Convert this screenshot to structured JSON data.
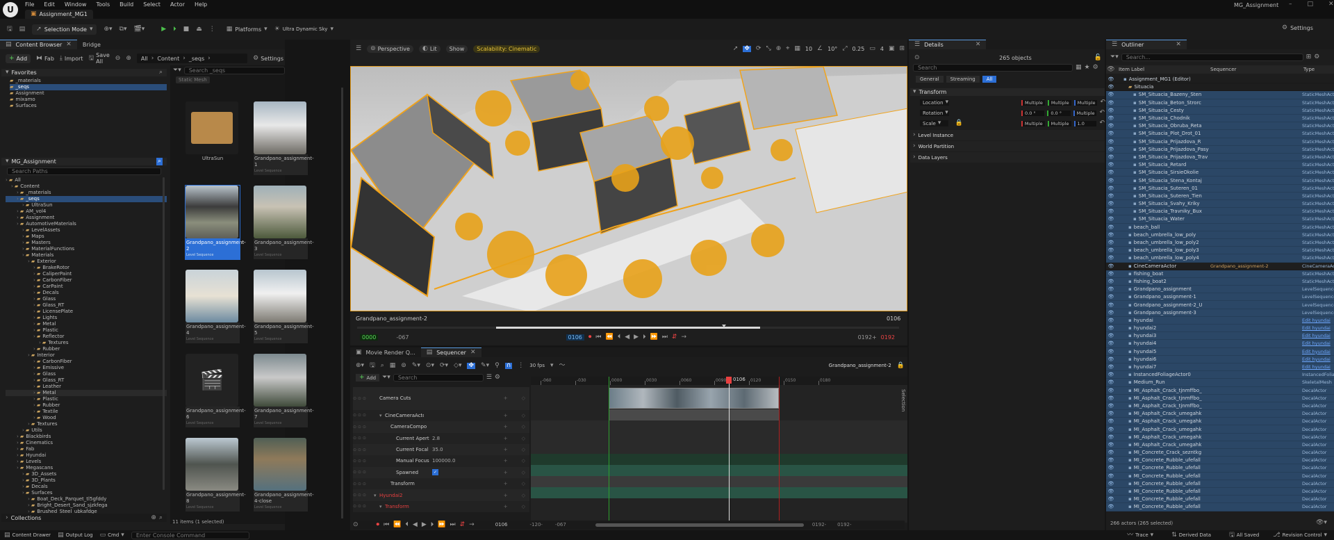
{
  "menubar": {
    "menus": [
      "File",
      "Edit",
      "Window",
      "Tools",
      "Build",
      "Select",
      "Actor",
      "Help"
    ],
    "project_title": "MG_Assignment",
    "tab": "Assignment_MG1"
  },
  "toolbar": {
    "selection_mode": "Selection Mode",
    "platforms": "Platforms",
    "sky": "Ultra Dynamic Sky",
    "settings": "Settings"
  },
  "content_browser": {
    "tabs": [
      "Content Browser",
      "Bridge"
    ],
    "add": "Add",
    "fab": "Fab",
    "import": "Import",
    "save_all": "Save All",
    "settings": "Settings",
    "path": [
      "All",
      "Content",
      "_seqs"
    ],
    "favorites_label": "Favorites",
    "favorites": [
      "_materials",
      "_seqs",
      "Assignment",
      "mixamo",
      "Surfaces"
    ],
    "root_label": "MG_Assignment",
    "search_paths_placeholder": "Search Paths",
    "search_placeholder": "Search _seqs",
    "filter_chip": "Static Mesh",
    "tree": [
      {
        "label": "All",
        "d": 0
      },
      {
        "label": "Content",
        "d": 1
      },
      {
        "label": "_materials",
        "d": 2
      },
      {
        "label": "_seqs",
        "d": 2,
        "sel": true
      },
      {
        "label": "UltraSun",
        "d": 3
      },
      {
        "label": "AM_vol4",
        "d": 2
      },
      {
        "label": "Assignment",
        "d": 2
      },
      {
        "label": "AutomotiveMaterials",
        "d": 2
      },
      {
        "label": "LevelAssets",
        "d": 3
      },
      {
        "label": "Maps",
        "d": 3
      },
      {
        "label": "Masters",
        "d": 3
      },
      {
        "label": "MaterialFunctions",
        "d": 3
      },
      {
        "label": "Materials",
        "d": 3
      },
      {
        "label": "Exterior",
        "d": 4
      },
      {
        "label": "BrakeRotor",
        "d": 5
      },
      {
        "label": "CaliperPaint",
        "d": 5
      },
      {
        "label": "CarbonFiber",
        "d": 5
      },
      {
        "label": "CarPaint",
        "d": 5
      },
      {
        "label": "Decals",
        "d": 5
      },
      {
        "label": "Glass",
        "d": 5
      },
      {
        "label": "Glass_RT",
        "d": 5
      },
      {
        "label": "LicensePlate",
        "d": 5
      },
      {
        "label": "Lights",
        "d": 5
      },
      {
        "label": "Metal",
        "d": 5
      },
      {
        "label": "Plastic",
        "d": 5
      },
      {
        "label": "Reflector",
        "d": 5
      },
      {
        "label": "Textures",
        "d": 6
      },
      {
        "label": "Rubber",
        "d": 5
      },
      {
        "label": "Interior",
        "d": 4
      },
      {
        "label": "CarbonFiber",
        "d": 5
      },
      {
        "label": "Emissive",
        "d": 5
      },
      {
        "label": "Glass",
        "d": 5
      },
      {
        "label": "Glass_RT",
        "d": 5
      },
      {
        "label": "Leather",
        "d": 5
      },
      {
        "label": "Metal",
        "d": 5,
        "hi": true
      },
      {
        "label": "Plastic",
        "d": 5
      },
      {
        "label": "Rubber",
        "d": 5
      },
      {
        "label": "Textile",
        "d": 5
      },
      {
        "label": "Wood",
        "d": 5
      },
      {
        "label": "Textures",
        "d": 4
      },
      {
        "label": "Utils",
        "d": 3
      },
      {
        "label": "Blackbirds",
        "d": 2
      },
      {
        "label": "Cinematics",
        "d": 2
      },
      {
        "label": "Fab",
        "d": 2
      },
      {
        "label": "Hyundai",
        "d": 2
      },
      {
        "label": "Levels",
        "d": 2
      },
      {
        "label": "Megascans",
        "d": 2
      },
      {
        "label": "3D_Assets",
        "d": 3
      },
      {
        "label": "3D_Plants",
        "d": 3
      },
      {
        "label": "Decals",
        "d": 3
      },
      {
        "label": "Surfaces",
        "d": 3
      },
      {
        "label": "Boat_Deck_Parquet_tl5gfddy",
        "d": 4
      },
      {
        "label": "Bright_Desert_Sand_sjzkfega",
        "d": 4
      },
      {
        "label": "Brushed_Steel_ubkafdge",
        "d": 4
      }
    ],
    "assets": [
      {
        "name": "UltraSun",
        "sub": "",
        "kind": "folder"
      },
      {
        "name": "Grandpano_assignment-1",
        "sub": "Level Sequence",
        "kind": "photo1"
      },
      {
        "name": "Grandpano_assignment-2",
        "sub": "Level Sequence",
        "kind": "photo2",
        "selected": true
      },
      {
        "name": "Grandpano_assignment-3",
        "sub": "Level Sequence",
        "kind": "photo3"
      },
      {
        "name": "Grandpano_assignment-4",
        "sub": "Level Sequence",
        "kind": "photo4"
      },
      {
        "name": "Grandpano_assignment-5",
        "sub": "Level Sequence",
        "kind": "photo5"
      },
      {
        "name": "Grandpano_assignment-6",
        "sub": "Level Sequence",
        "kind": "clapper"
      },
      {
        "name": "Grandpano_assignment-7",
        "sub": "Level Sequence",
        "kind": "photo6"
      },
      {
        "name": "Grandpano_assignment-8",
        "sub": "Level Sequence",
        "kind": "photo7"
      },
      {
        "name": "Grandpano_assignment-4-close",
        "sub": "Level Sequence",
        "kind": "photo8"
      }
    ],
    "status": "11 items (1 selected)",
    "collections": "Collections"
  },
  "viewport": {
    "perspective": "Perspective",
    "lit": "Lit",
    "show": "Show",
    "scalability": "Scalability: Cinematic",
    "grid": "10",
    "angle": "10°",
    "scale": "0.25",
    "cam": "4",
    "seq_name": "Grandpano_assignment-2",
    "frame_right": "0106",
    "start": "0000",
    "prestart": "-067",
    "cursor": "0106",
    "end": "0192+",
    "post": "0192"
  },
  "details": {
    "tab": "Details",
    "count": "265 objects",
    "search": "Search",
    "filters": [
      "General",
      "Streaming",
      "All"
    ],
    "section": "Transform",
    "location": "Location",
    "rotation": "Rotation",
    "scale": "Scale",
    "multiple": "Multiple",
    "rot_val": "0.0 °",
    "scale_val": "1.0",
    "sections": [
      "Level Instance",
      "World Partition",
      "Data Layers"
    ]
  },
  "outliner": {
    "tab": "Outliner",
    "search": "Search...",
    "col_label": "Item Label",
    "col_seq": "Sequencer",
    "col_type": "Type",
    "rows": [
      {
        "n": "Assignment_MG1 (Editor)",
        "t": "",
        "d": 1,
        "sel": false
      },
      {
        "n": "Situacia",
        "t": "",
        "d": 2,
        "sel": false,
        "folder": true
      },
      {
        "n": "SM_Situacia_Bazeny_Sten",
        "t": "StaticMeshAct",
        "d": 3,
        "sel": true
      },
      {
        "n": "SM_Situacia_Beton_Strorc",
        "t": "StaticMeshAct",
        "d": 3,
        "sel": true
      },
      {
        "n": "SM_Situacia_Cesty",
        "t": "StaticMeshAct",
        "d": 3,
        "sel": true
      },
      {
        "n": "SM_Situacia_Chodnik",
        "t": "StaticMeshAct",
        "d": 3,
        "sel": true
      },
      {
        "n": "SM_Situacia_Obruba_Reta",
        "t": "StaticMeshAct",
        "d": 3,
        "sel": true
      },
      {
        "n": "SM_Situacia_Plot_Drot_01",
        "t": "StaticMeshAct",
        "d": 3,
        "sel": true
      },
      {
        "n": "SM_Situacia_Prijazdova_R",
        "t": "StaticMeshAct",
        "d": 3,
        "sel": true
      },
      {
        "n": "SM_Situacia_Prijazdova_Pasy",
        "t": "StaticMeshAct",
        "d": 3,
        "sel": true
      },
      {
        "n": "SM_Situacia_Prijazdova_Trav",
        "t": "StaticMeshAct",
        "d": 3,
        "sel": true
      },
      {
        "n": "SM_Situacia_Retard",
        "t": "StaticMeshAct",
        "d": 3,
        "sel": true
      },
      {
        "n": "SM_Situacia_SirsieOkolie",
        "t": "StaticMeshAct",
        "d": 3,
        "sel": true
      },
      {
        "n": "SM_Situacia_Stena_Kontaj",
        "t": "StaticMeshAct",
        "d": 3,
        "sel": true
      },
      {
        "n": "SM_Situacia_Suteren_01",
        "t": "StaticMeshAct",
        "d": 3,
        "sel": true
      },
      {
        "n": "SM_Situacia_Suteren_Tien",
        "t": "StaticMeshAct",
        "d": 3,
        "sel": true
      },
      {
        "n": "SM_Situacia_Svahy_Kriky",
        "t": "StaticMeshAct",
        "d": 3,
        "sel": true
      },
      {
        "n": "SM_Situacia_Travniky_Bux",
        "t": "StaticMeshAct",
        "d": 3,
        "sel": true
      },
      {
        "n": "SM_Situacia_Water",
        "t": "StaticMeshAct",
        "d": 3,
        "sel": true
      },
      {
        "n": "beach_ball",
        "t": "StaticMeshAct",
        "d": 2,
        "sel": true
      },
      {
        "n": "beach_umbrella_low_poly",
        "t": "StaticMeshAct",
        "d": 2,
        "sel": true
      },
      {
        "n": "beach_umbrella_low_poly2",
        "t": "StaticMeshAct",
        "d": 2,
        "sel": true
      },
      {
        "n": "beach_umbrella_low_poly3",
        "t": "StaticMeshAct",
        "d": 2,
        "sel": true
      },
      {
        "n": "beach_umbrella_low_poly4",
        "t": "StaticMeshAct",
        "d": 2,
        "sel": true
      },
      {
        "n": "CineCameraActor",
        "t": "CineCameraAct",
        "d": 2,
        "sel": false,
        "seq": "Grandpano_assignment-2"
      },
      {
        "n": "fishing_boat",
        "t": "StaticMeshAct",
        "d": 2,
        "sel": true
      },
      {
        "n": "fishing_boat2",
        "t": "StaticMeshAct",
        "d": 2,
        "sel": true
      },
      {
        "n": "Grandpano_assignment",
        "t": "LevelSequence",
        "d": 2,
        "sel": true
      },
      {
        "n": "Grandpano_assignment-1",
        "t": "LevelSequence",
        "d": 2,
        "sel": true
      },
      {
        "n": "Grandpano_assignment-2_U",
        "t": "LevelSequence",
        "d": 2,
        "sel": true
      },
      {
        "n": "Grandpano_assignment-3",
        "t": "LevelSequence",
        "d": 2,
        "sel": true
      },
      {
        "n": "hyundai",
        "t": "Edit hyundai",
        "d": 2,
        "sel": true,
        "link": true
      },
      {
        "n": "hyundai2",
        "t": "Edit hyundai",
        "d": 2,
        "sel": true,
        "link": true
      },
      {
        "n": "hyundai3",
        "t": "Edit hyundai",
        "d": 2,
        "sel": true,
        "link": true
      },
      {
        "n": "hyundai4",
        "t": "Edit hyundai",
        "d": 2,
        "sel": true,
        "link": true
      },
      {
        "n": "hyundai5",
        "t": "Edit hyundai",
        "d": 2,
        "sel": true,
        "link": true
      },
      {
        "n": "hyundai6",
        "t": "Edit hyundai",
        "d": 2,
        "sel": true,
        "link": true
      },
      {
        "n": "hyundai7",
        "t": "Edit hyundai",
        "d": 2,
        "sel": true,
        "link": true
      },
      {
        "n": "InstancedFoliageActor0",
        "t": "InstancedFolia",
        "d": 2,
        "sel": true
      },
      {
        "n": "Medium_Run",
        "t": "SkeletalMesh",
        "d": 2,
        "sel": true
      },
      {
        "n": "MI_Asphalt_Crack_tjnmffbo_",
        "t": "DecalActor",
        "d": 2,
        "sel": true
      },
      {
        "n": "MI_Asphalt_Crack_tjnmffbo_",
        "t": "DecalActor",
        "d": 2,
        "sel": true
      },
      {
        "n": "MI_Asphalt_Crack_tjnmffbo_",
        "t": "DecalActor",
        "d": 2,
        "sel": true
      },
      {
        "n": "MI_Asphalt_Crack_umegahk",
        "t": "DecalActor",
        "d": 2,
        "sel": true
      },
      {
        "n": "MI_Asphalt_Crack_umegahk",
        "t": "DecalActor",
        "d": 2,
        "sel": true
      },
      {
        "n": "MI_Asphalt_Crack_umegahk",
        "t": "DecalActor",
        "d": 2,
        "sel": true
      },
      {
        "n": "MI_Asphalt_Crack_umegahk",
        "t": "DecalActor",
        "d": 2,
        "sel": true
      },
      {
        "n": "MI_Asphalt_Crack_umegahk",
        "t": "DecalActor",
        "d": 2,
        "sel": true
      },
      {
        "n": "MI_Concrete_Crack_sezntkg",
        "t": "DecalActor",
        "d": 2,
        "sel": true
      },
      {
        "n": "MI_Concrete_Rubble_ufefall",
        "t": "DecalActor",
        "d": 2,
        "sel": true
      },
      {
        "n": "MI_Concrete_Rubble_ufefall",
        "t": "DecalActor",
        "d": 2,
        "sel": true
      },
      {
        "n": "MI_Concrete_Rubble_ufefall",
        "t": "DecalActor",
        "d": 2,
        "sel": true
      },
      {
        "n": "MI_Concrete_Rubble_ufefall",
        "t": "DecalActor",
        "d": 2,
        "sel": true
      },
      {
        "n": "MI_Concrete_Rubble_ufefall",
        "t": "DecalActor",
        "d": 2,
        "sel": true
      },
      {
        "n": "MI_Concrete_Rubble_ufefall",
        "t": "DecalActor",
        "d": 2,
        "sel": true
      },
      {
        "n": "MI_Concrete_Rubble_ufefall",
        "t": "DecalActor",
        "d": 2,
        "sel": true
      }
    ],
    "status": "266 actors (265 selected)"
  },
  "sequencer": {
    "tabs": [
      "Movie Render Q...",
      "Sequencer"
    ],
    "fps": "30 fps",
    "name": "Grandpano_assignment-2",
    "add": "Add",
    "search": "Search",
    "tracks": [
      {
        "label": "Camera Cuts",
        "d": 0,
        "val": ""
      },
      {
        "label": "CineCameraActor",
        "d": 1,
        "val": ""
      },
      {
        "label": "CameraComponent",
        "d": 2,
        "val": ""
      },
      {
        "label": "Current Aperture",
        "d": 3,
        "val": "2.8"
      },
      {
        "label": "Current Focal Le",
        "d": 3,
        "val": "35.0"
      },
      {
        "label": "Manual Focus D",
        "d": 3,
        "val": "100000.0"
      },
      {
        "label": "Spawned",
        "d": 3,
        "val": "✓"
      },
      {
        "label": "Transform",
        "d": 2,
        "val": ""
      },
      {
        "label": "Hyundai2",
        "d": 0,
        "val": "",
        "red": true
      },
      {
        "label": "Transform",
        "d": 1,
        "val": "",
        "red": true
      }
    ],
    "ticks": [
      "-060",
      "-030",
      "0000",
      "0030",
      "0060",
      "0090",
      "0120",
      "0150",
      "0180"
    ],
    "playhead": "0106",
    "frame": "0106",
    "bottom_left1": "-120-",
    "bottom_left2": "-067",
    "bottom_right1": "0192-",
    "bottom_right2": "0192-",
    "selection": "Selection"
  },
  "statusbar": {
    "content_drawer": "Content Drawer",
    "output_log": "Output Log",
    "cmd": "Cmd",
    "console": "Enter Console Command",
    "trace": "Trace",
    "derived": "Derived Data",
    "saved": "All Saved",
    "revision": "Revision Control"
  }
}
